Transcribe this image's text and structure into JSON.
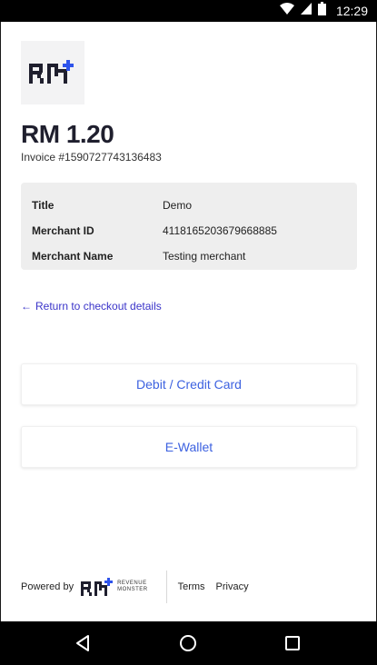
{
  "status_bar": {
    "time": "12:29",
    "icons": [
      "wifi-icon",
      "signal-icon",
      "battery-icon"
    ]
  },
  "merchant_logo": {
    "lettering": "RM"
  },
  "payment": {
    "amount": "RM 1.20",
    "invoice": "Invoice #1590727743136483"
  },
  "details": [
    {
      "key": "Title",
      "value": "Demo"
    },
    {
      "key": "Merchant ID",
      "value": "4118165203679668885"
    },
    {
      "key": "Merchant Name",
      "value": "Testing merchant"
    }
  ],
  "return_link": {
    "arrow": "←",
    "label": "Return to checkout details"
  },
  "methods": {
    "card_label": "Debit / Credit Card",
    "wallet_label": "E-Wallet"
  },
  "footer": {
    "powered_by": "Powered by",
    "brand_lettering": "RM",
    "brand_line1": "REVENUE",
    "brand_line2": "MONSTER",
    "terms": "Terms",
    "privacy": "Privacy"
  },
  "nav_bar": {
    "buttons": [
      "back-icon",
      "home-icon",
      "recents-icon"
    ]
  },
  "colors": {
    "accent": "#3d62e0",
    "link": "#3a34c9",
    "logo_plus": "#2f54eb",
    "text_dark": "#1f1f2e",
    "panel": "#eeeeee"
  }
}
